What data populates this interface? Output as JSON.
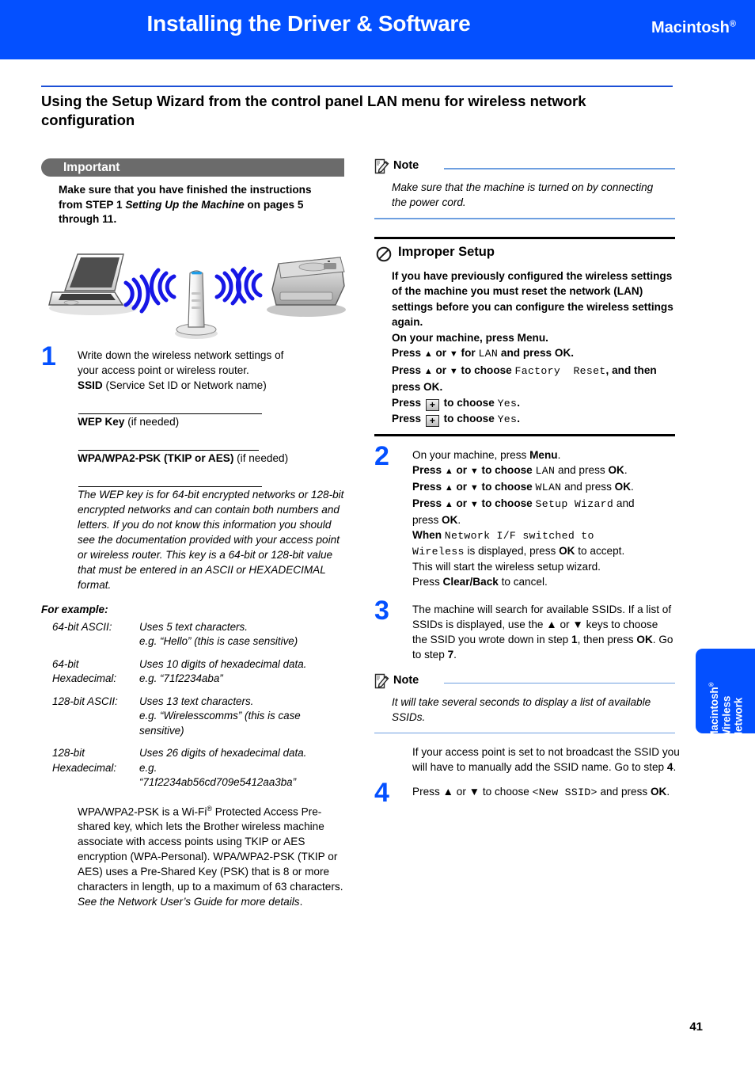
{
  "header": {
    "title": "Installing the Driver & Software",
    "platform": "Macintosh",
    "platform_mark": "®",
    "bg_color": "#0450FF"
  },
  "section": {
    "title": "Using the Setup Wizard from the control panel LAN menu for wireless network configuration",
    "rule_color": "#1b4fd6"
  },
  "left_column": {
    "important": {
      "label": "Important",
      "bar_color": "#6b6b6b",
      "text_before_italic": "Make sure that you have finished the instructions from STEP 1 ",
      "text_italic": "Setting Up the Machine",
      "text_after_italic": " on pages 5 through 11."
    },
    "illustration": {
      "name": "wireless-network-diagram",
      "items": [
        "laptop",
        "wireless-access-point",
        "brother-printer"
      ],
      "signal_color": "#1717e6"
    },
    "step1": {
      "number": "1",
      "line1": "Write down the wireless network settings of",
      "line2": "your access point or wireless router.",
      "ssid_bold": "SSID",
      "ssid_rest": " (Service Set ID or Network name)",
      "wep_bold": "WEP Key",
      "wep_rest": " (if needed)",
      "wpa_bold": "WPA/WPA2-PSK (TKIP or AES)",
      "wpa_rest": " (if needed)",
      "wep_note": "The WEP key is for 64-bit encrypted networks or 128-bit encrypted networks and can contain both numbers and letters. If you do not know this information you should see the documentation provided with your access point or wireless router. This key is a 64-bit or 128-bit value that must be entered in an ASCII or HEXADECIMAL format."
    },
    "for_example_label": "For example:",
    "examples": [
      {
        "key": "64-bit ASCII:",
        "lines": [
          "Uses 5 text characters.",
          "e.g. “Hello” (this is case sensitive)"
        ]
      },
      {
        "key": "64-bit Hexadecimal:",
        "lines": [
          "Uses 10 digits of hexadecimal data.",
          "e.g. “71f2234aba”"
        ]
      },
      {
        "key": "128-bit ASCII:",
        "lines": [
          "Uses 13 text characters.",
          "e.g. “Wirelesscomms” (this is case sensitive)"
        ]
      },
      {
        "key": "128-bit Hexadecimal:",
        "lines": [
          "Uses 26 digits of hexadecimal data.",
          "e.g.",
          "“71f2234ab56cd709e5412aa3ba”"
        ]
      }
    ],
    "wpa_paragraph": {
      "part1": "WPA/WPA2-PSK is a Wi-Fi",
      "mark": "®",
      "part2": " Protected Access Pre-shared key, which lets the Brother wireless machine associate with access points using TKIP or AES encryption (WPA-Personal). WPA/WPA2-PSK (TKIP or AES) uses a Pre-Shared Key (PSK) that is 8 or more characters in length, up to a maximum of 63 characters. ",
      "italic_tail": "See the Network User’s Guide for more details",
      "period": "."
    }
  },
  "right_column": {
    "note1": {
      "icon": "note-pencil-icon",
      "label": "Note",
      "body": "Make sure that the machine is turned on by connecting the power cord.",
      "rule_color": "#6e9fe0"
    },
    "improper_setup": {
      "icon": "prohibited-icon",
      "label": "Improper Setup",
      "lines": [
        "If you have previously configured the wireless settings of the machine you must reset the network (LAN) settings before you can configure the wireless settings again.",
        "On your machine, press Menu.",
        "Press ▲ or ▼ for LAN and press OK.",
        "Press ▲ or ▼ to choose Factory Reset, and then press OK.",
        "Press [+] to choose Yes.",
        "Press [+] to choose Yes."
      ],
      "mono_terms": [
        "LAN",
        "Factory Reset",
        "Yes"
      ],
      "keycap_label": "+"
    },
    "step2": {
      "number": "2",
      "l1_a": "On your machine, press ",
      "l1_b": "Menu",
      "l1_c": ".",
      "l2_a": "Press ▲ or ▼ to choose ",
      "l2_mono": "LAN",
      "l2_b": " and press ",
      "l2_c": "OK",
      "l2_d": ".",
      "l3_mono": "WLAN",
      "l4_mono": "Setup Wizard",
      "l4_tail_a": " and",
      "l4_tail_b": "press ",
      "l4_tail_c": "OK",
      "l4_tail_d": ".",
      "l5_a": "When ",
      "l5_mono1": "Network I/F switched to",
      "l5_mono2": "Wireless",
      "l5_b": " is displayed, press ",
      "l5_c": "OK",
      "l5_d": " to accept.",
      "l6": "This will start the wireless setup wizard.",
      "l7_a": "Press ",
      "l7_b": "Clear/Back",
      "l7_c": " to cancel."
    },
    "step3": {
      "number": "3",
      "a": "The machine will search for available SSIDs. If a list of SSIDs is displayed, use the ▲ or ▼ keys to choose the SSID you wrote down in step ",
      "step_ref1": "1",
      "b": ", then press ",
      "ok": "OK",
      "c": ". Go to step ",
      "step_ref2": "7",
      "d": "."
    },
    "note2": {
      "icon": "note-pencil-icon",
      "label": "Note",
      "body": "It will take several seconds to display a list of available SSIDs.",
      "rule_color": "#6e9fe0"
    },
    "broadcast_para": {
      "a": "If your access point is set to not broadcast the SSID you will have to manually add the SSID name. Go to step ",
      "step_ref": "4",
      "b": "."
    },
    "step4": {
      "number": "4",
      "a": "Press ▲ or ▼ to choose ",
      "mono": "<New SSID>",
      "b": " and press ",
      "ok": "OK",
      "c": "."
    }
  },
  "side_tab": {
    "line1": "Macintosh",
    "mark": "®",
    "line2": "Wireless",
    "line3": "Network",
    "bg_color": "#0450FF"
  },
  "footer": {
    "page_number": "41"
  }
}
